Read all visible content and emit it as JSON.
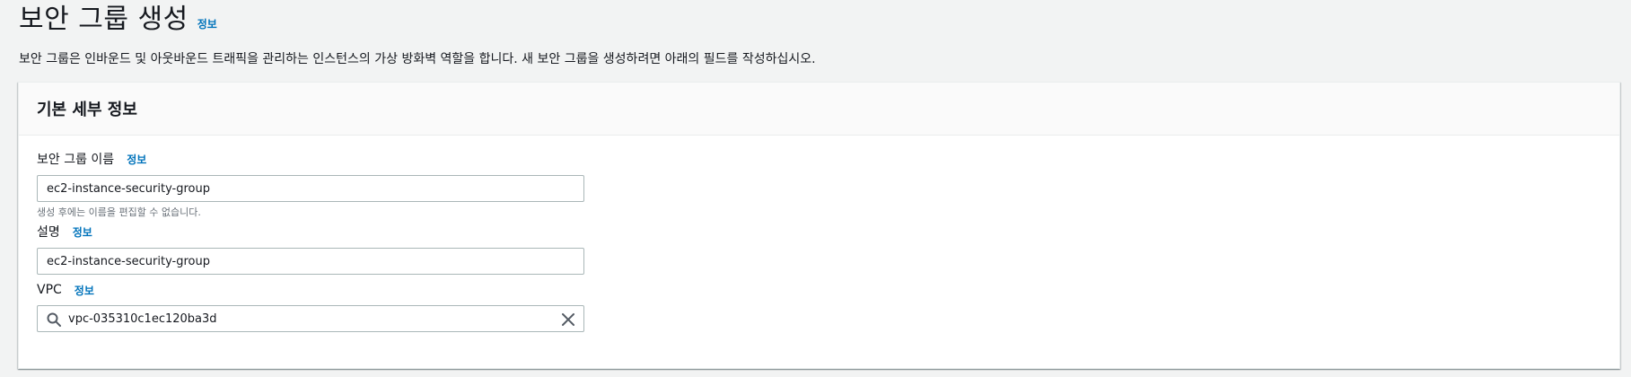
{
  "header": {
    "title": "보안 그룹 생성",
    "info_label": "정보",
    "description": "보안 그룹은 인바운드 및 아웃바운드 트래픽을 관리하는 인스턴스의 가상 방화벽 역할을 합니다. 새 보안 그룹을 생성하려면 아래의 필드를 작성하십시오."
  },
  "basic_details": {
    "title": "기본 세부 정보",
    "name_field": {
      "label": "보안 그룹 이름",
      "info_label": "정보",
      "value": "ec2-instance-security-group",
      "constraint": "생성 후에는 이름을 편집할 수 없습니다."
    },
    "description_field": {
      "label": "설명",
      "info_label": "정보",
      "value": "ec2-instance-security-group"
    },
    "vpc_field": {
      "label": "VPC",
      "info_label": "정보",
      "value": "vpc-035310c1ec120ba3d"
    }
  },
  "icons": {
    "search": "search-icon",
    "clear": "close-icon"
  },
  "colors": {
    "link": "#0073bb",
    "background": "#f2f3f3",
    "border": "#aab7b8"
  }
}
